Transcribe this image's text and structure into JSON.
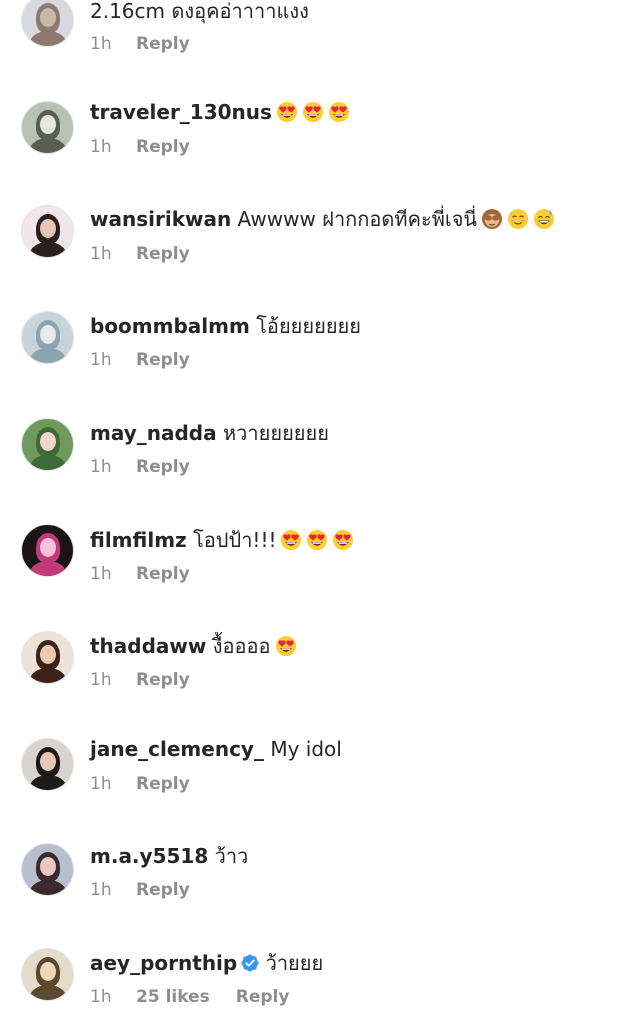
{
  "comments": [
    {
      "username": "",
      "text": "2.16cm ดงอุคอ่าาาาแงง",
      "emojis": [],
      "time": "1h",
      "likes": "",
      "reply": "Reply",
      "verified": false,
      "avatar_colors": [
        "#d8d8e0",
        "#8a7a70",
        "#c9b8a8"
      ]
    },
    {
      "username": "traveler_130nus",
      "text": "",
      "emojis": [
        "heart-eyes-emoji",
        "heart-eyes-emoji",
        "heart-eyes-emoji"
      ],
      "time": "1h",
      "likes": "",
      "reply": "Reply",
      "verified": false,
      "avatar_colors": [
        "#b9c0b4",
        "#5a5e52",
        "#e8e6e0"
      ]
    },
    {
      "username": "wansirikwan",
      "text": "Awwww ฝากกอดทีคะพี่เจนี่",
      "emojis": [
        "see-no-evil-monkey-emoji",
        "smiling-face-emoji",
        "grinning-sweat-emoji"
      ],
      "time": "1h",
      "likes": "",
      "reply": "Reply",
      "verified": false,
      "avatar_colors": [
        "#f3e6ea",
        "#2b2020",
        "#e8c4b8"
      ]
    },
    {
      "username": "boommbalmm",
      "text": "โอ้ยยยยยยย",
      "emojis": [],
      "time": "1h",
      "likes": "",
      "reply": "Reply",
      "verified": false,
      "avatar_colors": [
        "#c7d4dc",
        "#8ea4b0",
        "#e6e8ea"
      ]
    },
    {
      "username": "may_nadda",
      "text": "หวายยยยยย",
      "emojis": [],
      "time": "1h",
      "likes": "",
      "reply": "Reply",
      "verified": false,
      "avatar_colors": [
        "#6f9a5e",
        "#3f6a35",
        "#f0d6c8"
      ]
    },
    {
      "username": "filmfilmz",
      "text": "โอปป้า!!!",
      "emojis": [
        "heart-eyes-emoji",
        "heart-eyes-emoji",
        "heart-eyes-emoji"
      ],
      "time": "1h",
      "likes": "",
      "reply": "Reply",
      "verified": false,
      "avatar_colors": [
        "#1a1418",
        "#c23a78",
        "#f4c0dc"
      ]
    },
    {
      "username": "thaddaww",
      "text": "งื้ออออ",
      "emojis": [
        "heart-eyes-emoji"
      ],
      "time": "1h",
      "likes": "",
      "reply": "Reply",
      "verified": false,
      "avatar_colors": [
        "#efe2d8",
        "#3a2418",
        "#f0c8b0"
      ]
    },
    {
      "username": "jane_clemency_",
      "text": "My idol",
      "emojis": [],
      "time": "1h",
      "likes": "",
      "reply": "Reply",
      "verified": false,
      "avatar_colors": [
        "#d8d4d0",
        "#1e1a18",
        "#e8c8b4"
      ]
    },
    {
      "username": "m.a.y5518",
      "text": "ว้าว",
      "emojis": [],
      "time": "1h",
      "likes": "",
      "reply": "Reply",
      "verified": false,
      "avatar_colors": [
        "#b8c0d0",
        "#3a2a30",
        "#e8c8c0"
      ]
    },
    {
      "username": "aey_pornthip",
      "text": "ว้ายยย",
      "emojis": [],
      "time": "1h",
      "likes": "25 likes",
      "reply": "Reply",
      "verified": true,
      "avatar_colors": [
        "#e4dcc8",
        "#5a4a30",
        "#f0d8b8"
      ]
    }
  ],
  "colors": {
    "text": "#262626",
    "meta": "#8e8e8e",
    "verified_blue": "#3897f0",
    "emoji_yellow": "#ffcc33",
    "emoji_heart": "#e8233b"
  }
}
